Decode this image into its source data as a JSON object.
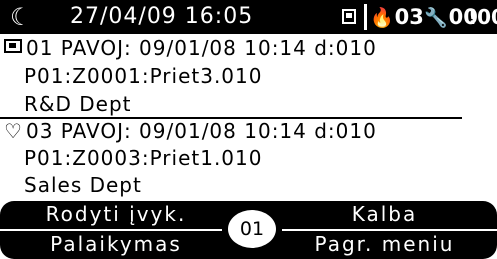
{
  "status_bar": {
    "moon_icon": "☾",
    "datetime": "27/04/09 16:05",
    "calendar_icon": "calendar-icon",
    "fire_icon": "🔥",
    "fire_count": "03",
    "wrench_icon": "🔧",
    "wrench_count": "00",
    "alert_icon": "!",
    "alert_count": "00"
  },
  "events": [
    {
      "icon": "box-icon",
      "header": "01 PAVOJ: 09/01/08 10:14 d:010",
      "zone": "P01:Z0001:Priet3.010",
      "dept": "R&D Dept"
    },
    {
      "icon": "♡",
      "header": "03 PAVOJ: 09/01/08 10:14 d:010",
      "zone": "P01:Z0003:Priet1.010",
      "dept": "Sales Dept"
    }
  ],
  "menu": {
    "events_button": "Rodyti įvyk.",
    "language_button": "Kalba",
    "support_button": "Palaikymas",
    "main_menu_button": "Pagr. meniu",
    "page_badge": "01"
  }
}
